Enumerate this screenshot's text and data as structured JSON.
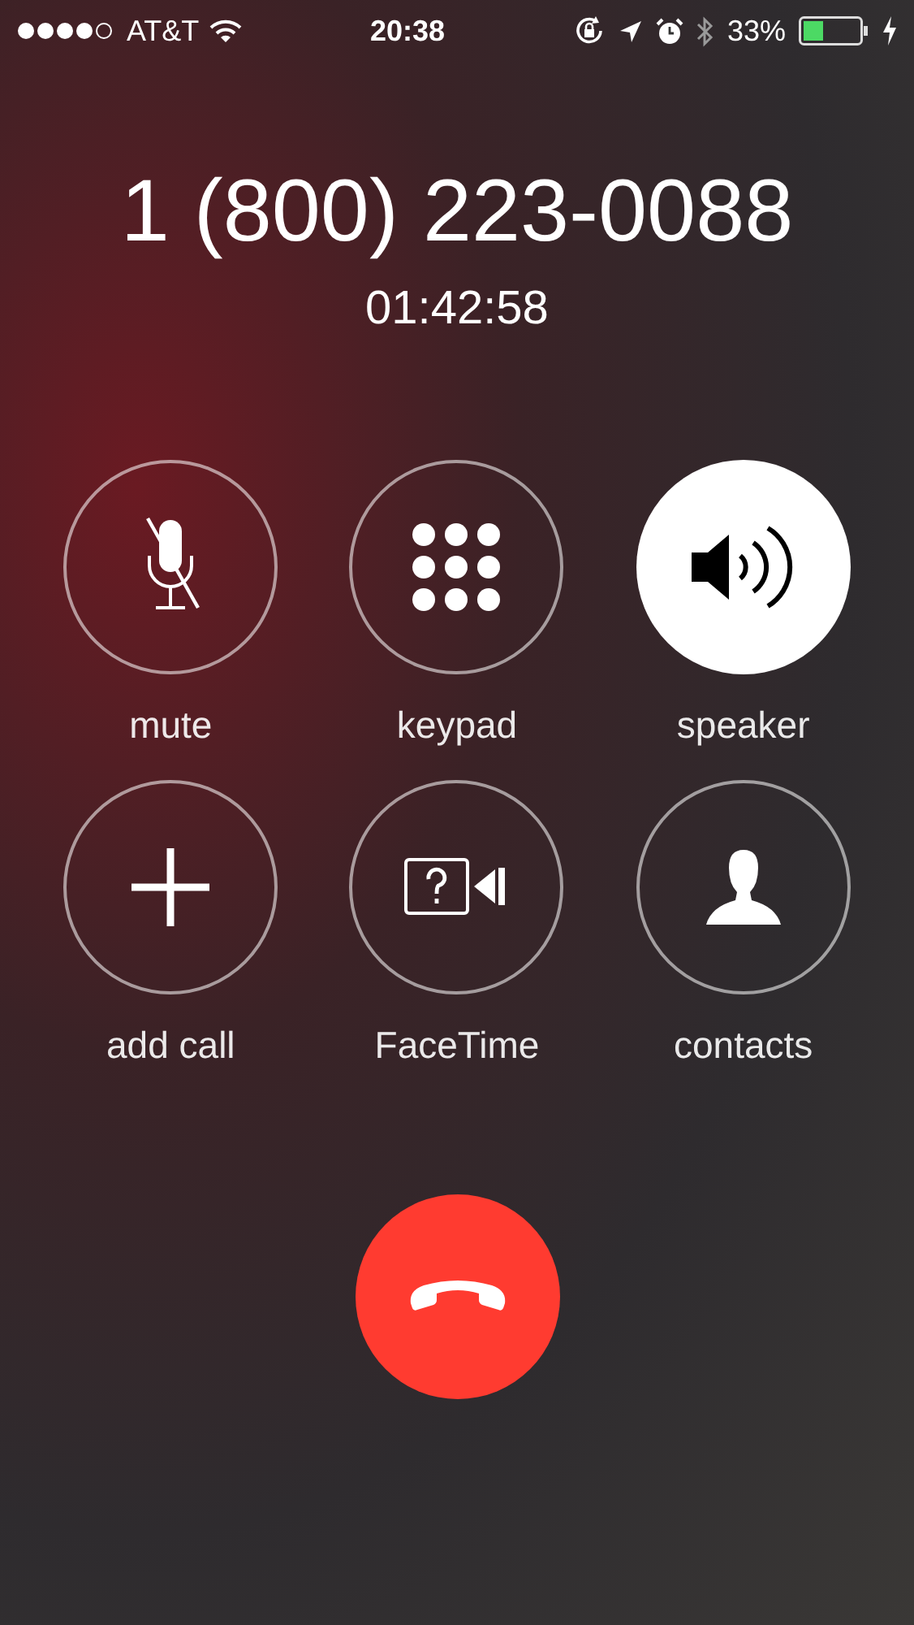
{
  "status_bar": {
    "carrier": "AT&T",
    "time": "20:38",
    "battery_percent": "33%"
  },
  "call": {
    "number": "1 (800) 223-0088",
    "duration": "01:42:58"
  },
  "controls": [
    {
      "kind": "mute",
      "label": "mute",
      "selected": false
    },
    {
      "kind": "keypad",
      "label": "keypad",
      "selected": false
    },
    {
      "kind": "speaker",
      "label": "speaker",
      "selected": true
    },
    {
      "kind": "add",
      "label": "add call",
      "selected": false
    },
    {
      "kind": "facetime",
      "label": "FaceTime",
      "selected": false
    },
    {
      "kind": "contacts",
      "label": "contacts",
      "selected": false
    }
  ],
  "end_call": {
    "kind": "end"
  }
}
